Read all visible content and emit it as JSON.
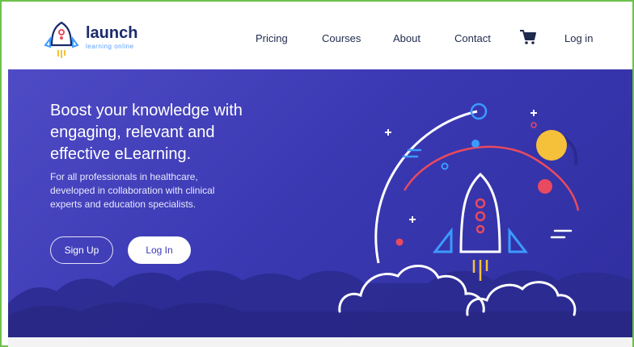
{
  "header": {
    "logo": {
      "name": "launch",
      "tagline": "learning online"
    },
    "nav": [
      {
        "label": "Pricing"
      },
      {
        "label": "Courses"
      },
      {
        "label": "About"
      },
      {
        "label": "Contact"
      },
      {
        "label": "Log in"
      }
    ]
  },
  "hero": {
    "headline_lines": [
      "Boost your knowledge with",
      "engaging, relevant and",
      "effective eLearning."
    ],
    "subtext_lines": [
      "For all professionals in healthcare,",
      "developed in collaboration with clinical",
      "experts and education specialists."
    ],
    "buttons": {
      "signup": "Sign Up",
      "login": "Log In"
    }
  },
  "colors": {
    "hero_bg": "#3b39b3",
    "accent_yellow": "#f6c13a",
    "accent_red": "#e84a5f",
    "accent_blue": "#3b9bff",
    "border_green": "#6cc04a"
  }
}
